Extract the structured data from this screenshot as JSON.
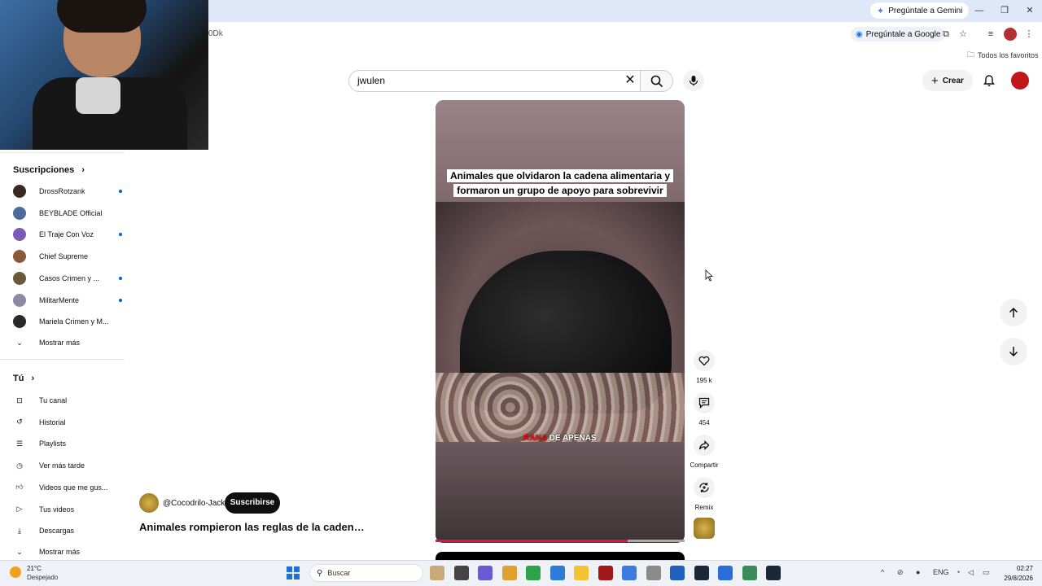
{
  "browser": {
    "gemini_label": "Pregúntale a Gemini",
    "url_tail": "0Dk",
    "ask_google_label": "Pregúntale a Google",
    "favorites_label": "Todos los favoritos"
  },
  "masthead": {
    "search_value": "jwulen",
    "create_label": "Crear"
  },
  "sidebar": {
    "subscriptions_title": "Suscripciones",
    "subscriptions": [
      {
        "label": "DrossRotzank",
        "new": true,
        "color": "#3a2a22"
      },
      {
        "label": "BEYBLADE Official",
        "new": false,
        "color": "#4c6a9a"
      },
      {
        "label": "El Traje Con Voz",
        "new": true,
        "color": "#7b5bb8"
      },
      {
        "label": "Chief Supreme",
        "new": false,
        "color": "#8a5a3a"
      },
      {
        "label": "Casos Crimen y ...",
        "new": true,
        "color": "#6a5a3a"
      },
      {
        "label": "MilitarMente",
        "new": true,
        "color": "#8a8aa8"
      },
      {
        "label": "Mariela Crimen y M...",
        "new": false,
        "color": "#2a2a2a"
      }
    ],
    "show_more_label": "Mostrar más",
    "you_title": "Tú",
    "you_items": [
      {
        "label": "Tu canal",
        "icon": "user-square-icon"
      },
      {
        "label": "Historial",
        "icon": "history-icon"
      },
      {
        "label": "Playlists",
        "icon": "playlist-icon"
      },
      {
        "label": "Ver más tarde",
        "icon": "clock-icon"
      },
      {
        "label": "Videos que me gus...",
        "icon": "thumbs-up-icon"
      },
      {
        "label": "Tus videos",
        "icon": "play-square-icon"
      },
      {
        "label": "Descargas",
        "icon": "download-icon"
      }
    ],
    "you_show_more_label": "Mostrar más"
  },
  "short": {
    "caption": "Animales que olvidaron la cadena alimentaria y formaron un grupo de apoyo para sobrevivir",
    "subtitle_red": "RANA",
    "subtitle_white": "DE APENAS",
    "progress": 0.77,
    "likes": "195 k",
    "comments": "454",
    "share_label": "Compartir",
    "remix_label": "Remix",
    "channel_name": "@Cocodrilo-Jack",
    "subscribe_label": "Suscribirse",
    "title": "Animales rompieron las reglas de la cadena ..."
  },
  "taskbar": {
    "weather_temp": "21°C",
    "weather_desc": "Despejado",
    "search_placeholder": "Buscar",
    "language": "ENG",
    "time": "02:27",
    "date": "29/8/2026"
  }
}
